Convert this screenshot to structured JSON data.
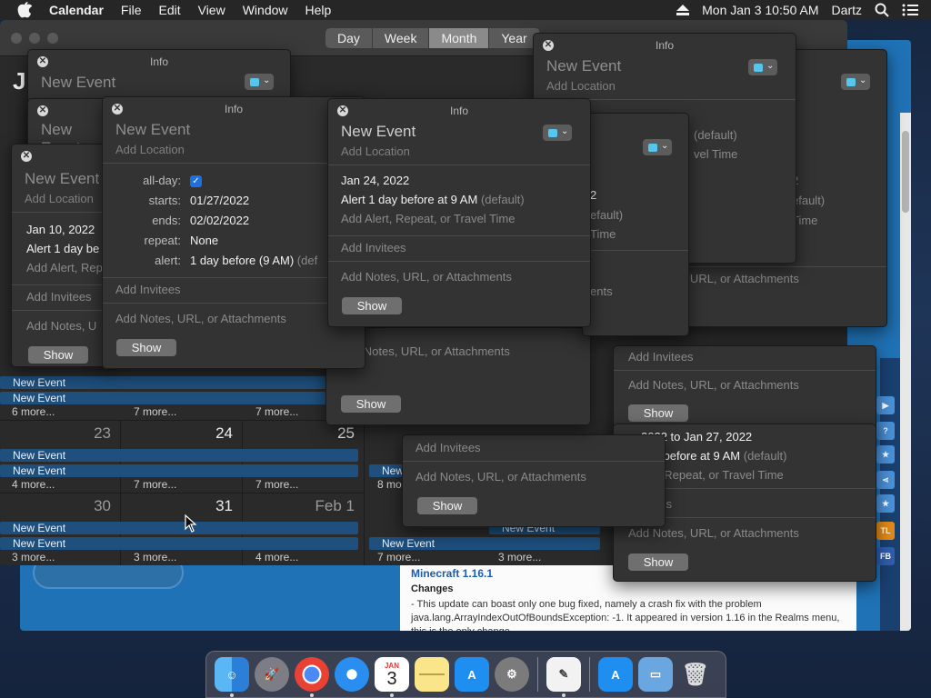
{
  "menubar": {
    "app": "Calendar",
    "items": [
      "File",
      "Edit",
      "View",
      "Window",
      "Help"
    ],
    "datetime": "Mon Jan 3  10:50 AM",
    "user": "Dartz"
  },
  "calendar": {
    "view_tabs": [
      "Day",
      "Week",
      "Month",
      "Year"
    ],
    "active_tab": "Month",
    "header_letter": "J",
    "weeks": [
      {
        "days": [],
        "events": [
          {
            "label": "New Event"
          },
          {
            "label": "New Event"
          }
        ],
        "more": [
          "6 more...",
          "7 more...",
          "7 more..."
        ]
      },
      {
        "days": [
          "23",
          "24",
          "25"
        ],
        "events": [
          {
            "label": "New Event"
          },
          {
            "label": "New Event"
          },
          {
            "label": "New"
          }
        ],
        "more": [
          "4 more...",
          "7 more...",
          "7 more...",
          "8 mo"
        ]
      },
      {
        "days": [
          "30",
          "31",
          "Feb 1"
        ],
        "events": [
          {
            "label": "New Event"
          },
          {
            "label": "New Event"
          },
          {
            "label": "New Event"
          },
          {
            "label": "New Event"
          }
        ],
        "more": [
          "3 more...",
          "3 more...",
          "4 more...",
          "7 more...",
          "3 more..."
        ]
      }
    ]
  },
  "popover_common": {
    "title": "Info",
    "event_name": "New Event",
    "location_placeholder": "Add Location",
    "alert_opts": "Add Alert, Repeat, or Travel Time",
    "invitees": "Add Invitees",
    "notes": "Add Notes, URL, or Attachments",
    "show_button": "Show",
    "default_tag": "(default)"
  },
  "pop_left": {
    "name_partial": "New Event",
    "date": "Jan 10, 2022",
    "alert": "Alert 1 day be",
    "alert_opts_partial": "Add Alert, Rep",
    "notes_partial": "Add Notes, U"
  },
  "pop_detail": {
    "allday_label": "all-day:",
    "starts_label": "starts:",
    "starts_value": "01/27/2022",
    "ends_label": "ends:",
    "ends_value": "02/02/2022",
    "repeat_label": "repeat:",
    "repeat_value": "None",
    "alert_label": "alert:",
    "alert_value": "1 day before (9 AM)",
    "alert_default_partial": "(def"
  },
  "pop_mid": {
    "date": "Jan 24, 2022",
    "alert": "Alert 1 day before at 9 AM"
  },
  "pop_right_partial": {
    "date_fragment": "2",
    "default_partial": "efault)",
    "time_partial": "Time",
    "default_partial_2": "(default)",
    "time_partial_2": "vel Time",
    "attach_partial": "ents"
  },
  "pop_far_right": {
    "date_partial": "2022 to Jan 27, 2022",
    "alert_partial": "day before at 9 AM",
    "alert_opts_partial": "lert, Repeat, or Travel Time",
    "invitees_partial": "vitees",
    "default_partial": "2",
    "default_tag_partial": "efault)",
    "time_partial": "Time"
  },
  "browser": {
    "bottom_title": "Minecraft 1.16.1",
    "bottom_subtitle": "Changes",
    "bottom_body": "- This update can boast only one bug fixed, namely a crash fix with the problem java.lang.ArrayIndexOutOfBoundsException: -1. It appeared in version 1.16 in the Realms menu, this is the only change.",
    "side_buttons": [
      "TL",
      "FB"
    ]
  },
  "dock": {
    "calendar_month": "JAN",
    "calendar_day": "3"
  },
  "colors": {
    "accent_blue": "#1e4f7d",
    "event_color_swatch": "#55c7ef",
    "checkbox_blue": "#1f6fe0"
  }
}
